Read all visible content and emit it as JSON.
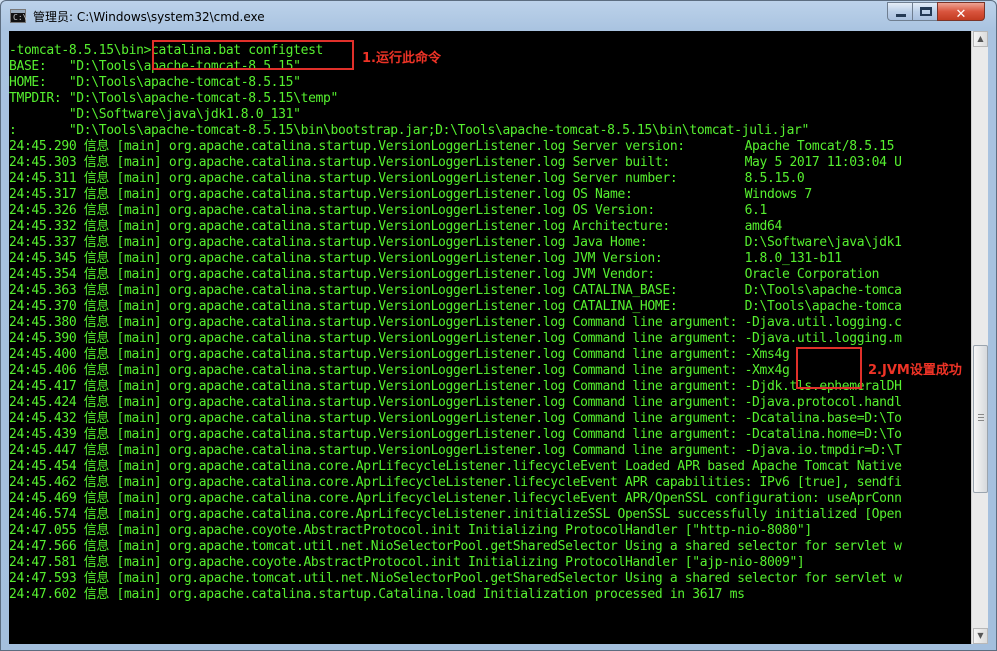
{
  "window": {
    "title": "管理员: C:\\Windows\\system32\\cmd.exe",
    "icon_text": "C:\\",
    "controls": {
      "minimize": "minimize-icon",
      "maximize": "maximize-icon",
      "close": "✕"
    }
  },
  "console": {
    "text_color": "#56f02f",
    "background": "#000000",
    "lines": [
      "-tomcat-8.5.15\\bin>catalina.bat configtest",
      "BASE:   \"D:\\Tools\\apache-tomcat-8.5.15\"",
      "HOME:   \"D:\\Tools\\apache-tomcat-8.5.15\"",
      "TMPDIR: \"D:\\Tools\\apache-tomcat-8.5.15\\temp\"",
      "        \"D:\\Software\\java\\jdk1.8.0_131\"",
      ":       \"D:\\Tools\\apache-tomcat-8.5.15\\bin\\bootstrap.jar;D:\\Tools\\apache-tomcat-8.5.15\\bin\\tomcat-juli.jar\"",
      "24:45.290 信息 [main] org.apache.catalina.startup.VersionLoggerListener.log Server version:        Apache Tomcat/8.5.15",
      "24:45.303 信息 [main] org.apache.catalina.startup.VersionLoggerListener.log Server built:          May 5 2017 11:03:04 U",
      "24:45.311 信息 [main] org.apache.catalina.startup.VersionLoggerListener.log Server number:         8.5.15.0",
      "24:45.317 信息 [main] org.apache.catalina.startup.VersionLoggerListener.log OS Name:               Windows 7",
      "24:45.326 信息 [main] org.apache.catalina.startup.VersionLoggerListener.log OS Version:            6.1",
      "24:45.332 信息 [main] org.apache.catalina.startup.VersionLoggerListener.log Architecture:          amd64",
      "24:45.337 信息 [main] org.apache.catalina.startup.VersionLoggerListener.log Java Home:             D:\\Software\\java\\jdk1",
      "24:45.345 信息 [main] org.apache.catalina.startup.VersionLoggerListener.log JVM Version:           1.8.0_131-b11",
      "24:45.354 信息 [main] org.apache.catalina.startup.VersionLoggerListener.log JVM Vendor:            Oracle Corporation",
      "24:45.363 信息 [main] org.apache.catalina.startup.VersionLoggerListener.log CATALINA_BASE:         D:\\Tools\\apache-tomca",
      "24:45.370 信息 [main] org.apache.catalina.startup.VersionLoggerListener.log CATALINA_HOME:         D:\\Tools\\apache-tomca",
      "24:45.380 信息 [main] org.apache.catalina.startup.VersionLoggerListener.log Command line argument: -Djava.util.logging.c",
      "24:45.390 信息 [main] org.apache.catalina.startup.VersionLoggerListener.log Command line argument: -Djava.util.logging.m",
      "24:45.400 信息 [main] org.apache.catalina.startup.VersionLoggerListener.log Command line argument: -Xms4g",
      "24:45.406 信息 [main] org.apache.catalina.startup.VersionLoggerListener.log Command line argument: -Xmx4g",
      "24:45.417 信息 [main] org.apache.catalina.startup.VersionLoggerListener.log Command line argument: -Djdk.tls.ephemeralDH",
      "24:45.424 信息 [main] org.apache.catalina.startup.VersionLoggerListener.log Command line argument: -Djava.protocol.handl",
      "24:45.432 信息 [main] org.apache.catalina.startup.VersionLoggerListener.log Command line argument: -Dcatalina.base=D:\\To",
      "24:45.439 信息 [main] org.apache.catalina.startup.VersionLoggerListener.log Command line argument: -Dcatalina.home=D:\\To",
      "24:45.447 信息 [main] org.apache.catalina.startup.VersionLoggerListener.log Command line argument: -Djava.io.tmpdir=D:\\T",
      "24:45.454 信息 [main] org.apache.catalina.core.AprLifecycleListener.lifecycleEvent Loaded APR based Apache Tomcat Native",
      "24:45.462 信息 [main] org.apache.catalina.core.AprLifecycleListener.lifecycleEvent APR capabilities: IPv6 [true], sendfi",
      "24:45.469 信息 [main] org.apache.catalina.core.AprLifecycleListener.lifecycleEvent APR/OpenSSL configuration: useAprConn",
      "24:46.574 信息 [main] org.apache.catalina.core.AprLifecycleListener.initializeSSL OpenSSL successfully initialized [Open",
      "24:47.055 信息 [main] org.apache.coyote.AbstractProtocol.init Initializing ProtocolHandler [\"http-nio-8080\"]",
      "24:47.566 信息 [main] org.apache.tomcat.util.net.NioSelectorPool.getSharedSelector Using a shared selector for servlet w",
      "24:47.581 信息 [main] org.apache.coyote.AbstractProtocol.init Initializing ProtocolHandler [\"ajp-nio-8009\"]",
      "24:47.593 信息 [main] org.apache.tomcat.util.net.NioSelectorPool.getSharedSelector Using a shared selector for servlet w",
      "24:47.602 信息 [main] org.apache.catalina.startup.Catalina.load Initialization processed in 3617 ms"
    ]
  },
  "annotations": [
    {
      "label": "1.运行此命令",
      "color": "#e0302a"
    },
    {
      "label": "2.JVM设置成功",
      "color": "#e0302a"
    }
  ]
}
